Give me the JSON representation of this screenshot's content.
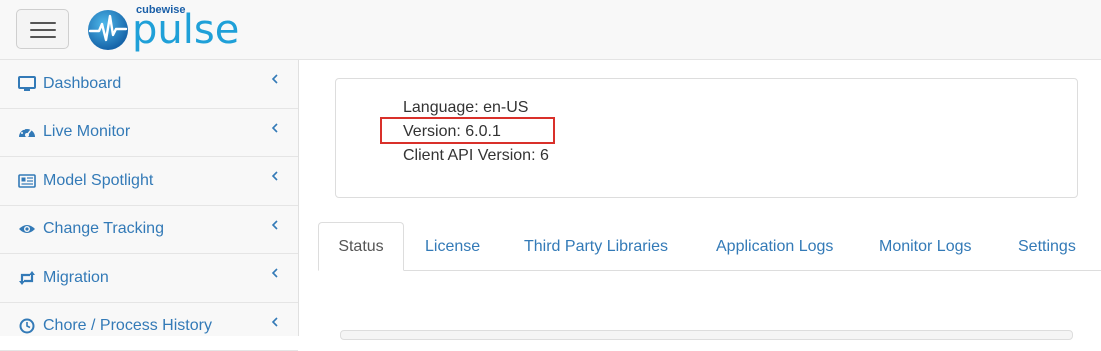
{
  "header": {
    "menu_toggle": "menu",
    "logo_top": "cubewise",
    "logo_main": "pulse",
    "brand_color": "#1fa0d8"
  },
  "sidebar": {
    "items": [
      {
        "label": "Dashboard",
        "icon": "monitor-icon"
      },
      {
        "label": "Live Monitor",
        "icon": "dashboard-gauge-icon"
      },
      {
        "label": "Model Spotlight",
        "icon": "newspaper-icon"
      },
      {
        "label": "Change Tracking",
        "icon": "eye-icon"
      },
      {
        "label": "Migration",
        "icon": "retweet-icon"
      },
      {
        "label": "Chore / Process History",
        "icon": "clock-icon"
      }
    ],
    "link_color": "#337ab7"
  },
  "info": {
    "language": "Language: en-US",
    "version": "Version: 6.0.1",
    "client_api": "Client API Version: 6",
    "highlight_color": "#d9302a"
  },
  "tabs": [
    {
      "label": "Status",
      "active": true
    },
    {
      "label": "License",
      "active": false
    },
    {
      "label": "Third Party Libraries",
      "active": false
    },
    {
      "label": "Application Logs",
      "active": false
    },
    {
      "label": "Monitor Logs",
      "active": false
    },
    {
      "label": "Settings",
      "active": false
    }
  ]
}
